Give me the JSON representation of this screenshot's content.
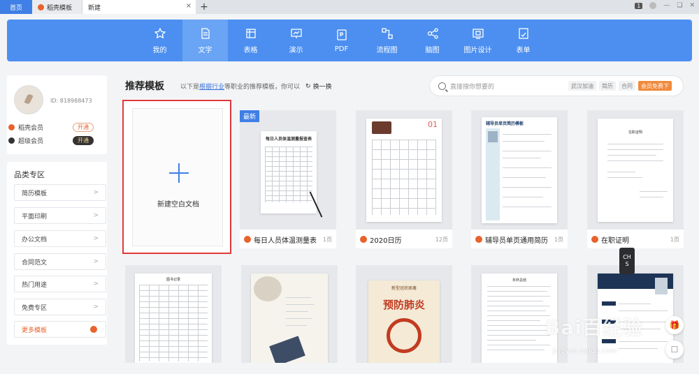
{
  "tabs": {
    "home": "首页",
    "daoke": "稻壳模板",
    "current": "新建",
    "close": "×",
    "plus": "+",
    "badge": "1"
  },
  "toolbar": {
    "items": [
      {
        "label": "我的",
        "icon": "star-icon"
      },
      {
        "label": "文字",
        "icon": "document-icon",
        "active": true
      },
      {
        "label": "表格",
        "icon": "table-icon"
      },
      {
        "label": "演示",
        "icon": "presentation-icon"
      },
      {
        "label": "PDF",
        "icon": "pdf-icon"
      },
      {
        "label": "流程图",
        "icon": "flowchart-icon"
      },
      {
        "label": "脑图",
        "icon": "mindmap-icon"
      },
      {
        "label": "图片设计",
        "icon": "image-design-icon"
      },
      {
        "label": "表单",
        "icon": "form-icon"
      }
    ]
  },
  "user": {
    "id": "ID: 818988473",
    "members": [
      {
        "label": "稻壳会员",
        "action": "开通"
      },
      {
        "label": "超级会员",
        "action": "开通"
      }
    ]
  },
  "categories": {
    "title": "品类专区",
    "items": [
      "简历模板",
      "平面印刷",
      "办公文档",
      "合同范文",
      "热门用途",
      "免费专区"
    ],
    "more": "更多模板",
    "chevron": ">"
  },
  "main": {
    "title": "推荐模板",
    "sub_prefix": "以下是",
    "sub_link": "根据行业",
    "sub_suffix": "等职业的推荐模板，你可以",
    "refresh": "换一换"
  },
  "search": {
    "placeholder": "直接搜你想要的",
    "chips": [
      "武汉加油",
      "简历",
      "合同"
    ],
    "promo": "会员免费下"
  },
  "blank": {
    "label": "新建空白文档"
  },
  "cards": [
    {
      "title": "每日人员体温测量表",
      "pages": "1页",
      "badge": "最新",
      "thumb_title": "每日人员体温测量报查表"
    },
    {
      "title": "2020日历",
      "pages": "12页",
      "thumb_number": "01"
    },
    {
      "title": "辅导员单页通用简历",
      "pages": "1页",
      "thumb_title": "辅导员单页简历模板"
    },
    {
      "title": "在职证明",
      "pages": "1页",
      "thumb_title": "在职证明"
    }
  ],
  "row2": {
    "sheet_title": "图书记录",
    "poster_small": "新型冠状病毒",
    "poster_big": "预防肺炎",
    "summary_title": "年终总结"
  },
  "side": {
    "chs": [
      "CH",
      "S"
    ],
    "gift_icon": "gift-icon",
    "chat_icon": "chat-icon"
  },
  "watermark": {
    "brand": "Bai百经验",
    "url": "jingyan.baidu.com"
  }
}
